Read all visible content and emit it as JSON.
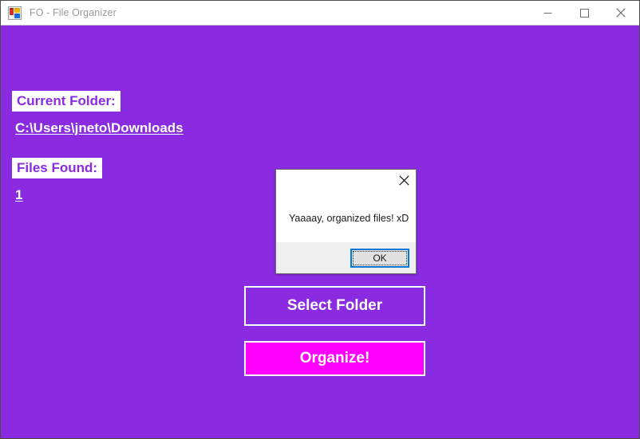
{
  "window": {
    "title": "FO - File Organizer",
    "icon": "app-window-panes-icon",
    "background_color": "#8A2BE2",
    "titlebar_background": "#ffffff",
    "titlebar_text_color": "#9a9a9a"
  },
  "window_controls": {
    "minimize": {
      "label": "Minimize",
      "icon": "minimize-icon"
    },
    "maximize": {
      "label": "Maximize",
      "icon": "maximize-icon"
    },
    "close": {
      "label": "Close",
      "icon": "close-icon"
    }
  },
  "main": {
    "current_folder": {
      "label": "Current Folder:",
      "value": "C:\\Users\\jneto\\Downloads",
      "label_text_color": "#8A2BE2",
      "label_background": "#ffffff",
      "value_text_color": "#ffffff"
    },
    "files_found": {
      "label": "Files Found:",
      "value": "1",
      "label_text_color": "#8A2BE2",
      "label_background": "#ffffff",
      "value_text_color": "#ffffff"
    },
    "buttons": {
      "select_folder": {
        "label": "Select Folder",
        "background": "#8A2BE2",
        "border_color": "#ffffff",
        "text_color": "#ffffff"
      },
      "organize": {
        "label": "Organize!",
        "background": "#FF00FF",
        "border_color": "#ffffff",
        "text_color": "#ffffff"
      }
    }
  },
  "dialog": {
    "message": "Yaaaay, organized files! xD",
    "ok_label": "OK",
    "close_icon": "close-icon",
    "body_background": "#ffffff",
    "footer_background": "#efefef",
    "ok_focus_border_color": "#0078D7",
    "ok_background": "#e1e1e1"
  }
}
